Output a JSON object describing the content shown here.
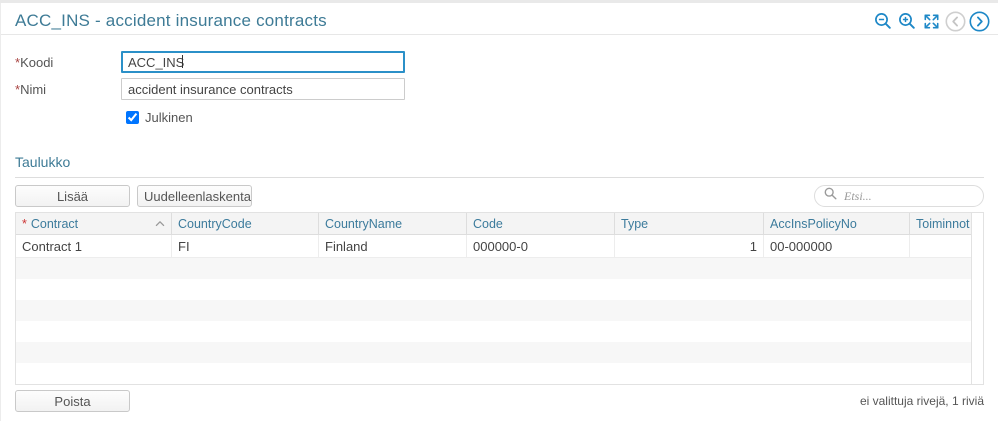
{
  "page_title": "ACC_INS - accident insurance contracts",
  "icons": {
    "zoom_out": "magnifier-minus",
    "zoom_in": "magnifier-plus",
    "fullscreen": "expand-arrows",
    "previous": "chevron-left-circle-disabled",
    "next": "chevron-right-circle",
    "search": "magnifier",
    "sort": "caret-up"
  },
  "colors": {
    "accent_blue": "#1e88c7",
    "heading_blue": "#3e7b96",
    "header_text_blue": "#3c7b9c",
    "required_red_form": "#a94442",
    "required_red_table": "#cc3333",
    "focus_border": "#2b90c8",
    "disabled_gray": "#c9c9c9",
    "stripe_gray": "#f7f7f7"
  },
  "form": {
    "koodi": {
      "required": "*",
      "label": "Koodi",
      "value": "ACC_INS"
    },
    "nimi": {
      "required": "*",
      "label": "Nimi",
      "value": "accident insurance contracts"
    },
    "checkbox": {
      "label": "Julkinen",
      "checked": "checked"
    }
  },
  "table_section": {
    "heading": "Taulukko",
    "buttons": {
      "add": "Lisää",
      "recalculate": "Uudelleenlaskenta",
      "delete": "Poista"
    },
    "search": {
      "placeholder": "Etsi..."
    },
    "columns": [
      {
        "required": "*",
        "label": "Contract",
        "sort": "asc"
      },
      {
        "label": "CountryCode"
      },
      {
        "label": "CountryName"
      },
      {
        "label": "Code"
      },
      {
        "label": "Type"
      },
      {
        "label": "AccInsPolicyNo"
      },
      {
        "label": "Toiminnot"
      }
    ],
    "rows": [
      [
        "Contract 1",
        "FI",
        "Finland",
        "000000-0",
        "1",
        "00-000000",
        ""
      ]
    ],
    "status": "ei valittuja rivejä, 1 riviä"
  }
}
